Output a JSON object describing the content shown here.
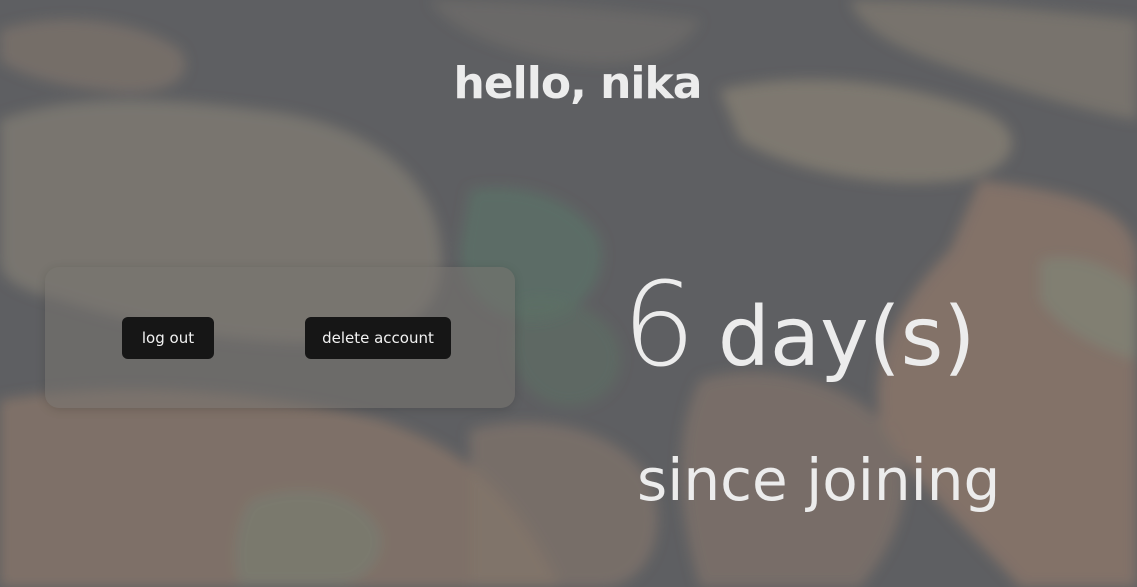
{
  "greeting": "hello, nika",
  "actions": {
    "logout_label": "log out",
    "delete_label": "delete account"
  },
  "stats": {
    "days_value": "6",
    "days_unit": "day(s)",
    "caption": "since joining"
  },
  "colors": {
    "background_base": "#5f6062",
    "button_bg": "#161616",
    "text": "#ececec"
  }
}
